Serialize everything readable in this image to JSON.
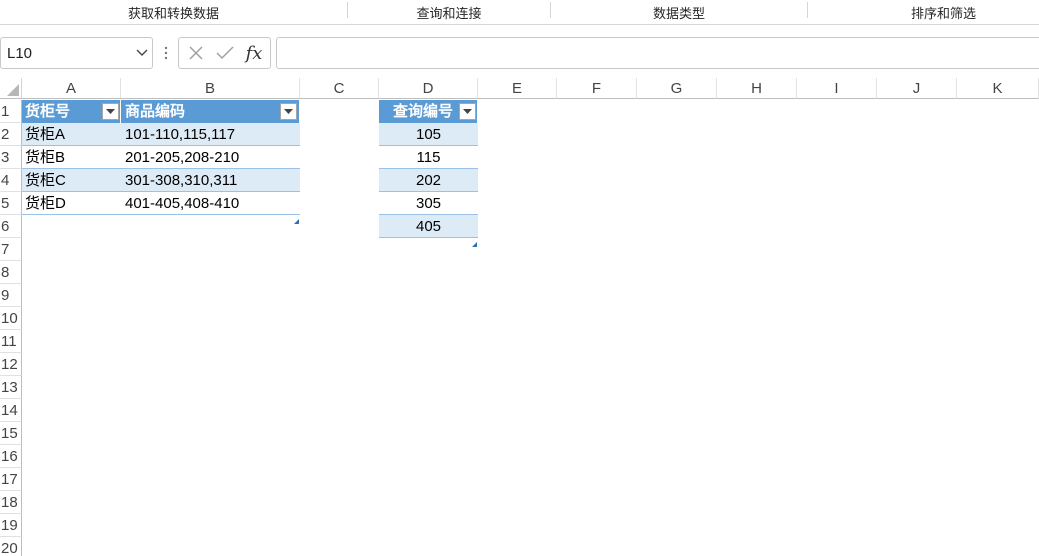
{
  "ribbon": {
    "groups": [
      "获取和转换数据",
      "查询和连接",
      "数据类型",
      "排序和筛选"
    ]
  },
  "formula_bar": {
    "name_box": "L10",
    "formula": ""
  },
  "grid": {
    "columns": [
      "A",
      "B",
      "C",
      "D",
      "E",
      "F",
      "G",
      "H",
      "I",
      "J",
      "K"
    ],
    "rows": [
      "1",
      "2",
      "3",
      "4",
      "5",
      "6",
      "7",
      "8",
      "9",
      "10",
      "11",
      "12",
      "13",
      "14",
      "15",
      "16",
      "17",
      "18",
      "19",
      "20"
    ]
  },
  "table1": {
    "headers": [
      "货柜号",
      "商品编码"
    ],
    "rows": [
      [
        "货柜A",
        "101-110,115,117"
      ],
      [
        "货柜B",
        "201-205,208-210"
      ],
      [
        "货柜C",
        "301-308,310,311"
      ],
      [
        "货柜D",
        "401-405,408-410"
      ]
    ]
  },
  "table2": {
    "header": "查询编号",
    "values": [
      "105",
      "115",
      "202",
      "305",
      "405"
    ]
  },
  "colors": {
    "header_fill": "#5b9bd5",
    "band_fill": "#ddebf7",
    "resize_handle": "#2f6eba"
  }
}
